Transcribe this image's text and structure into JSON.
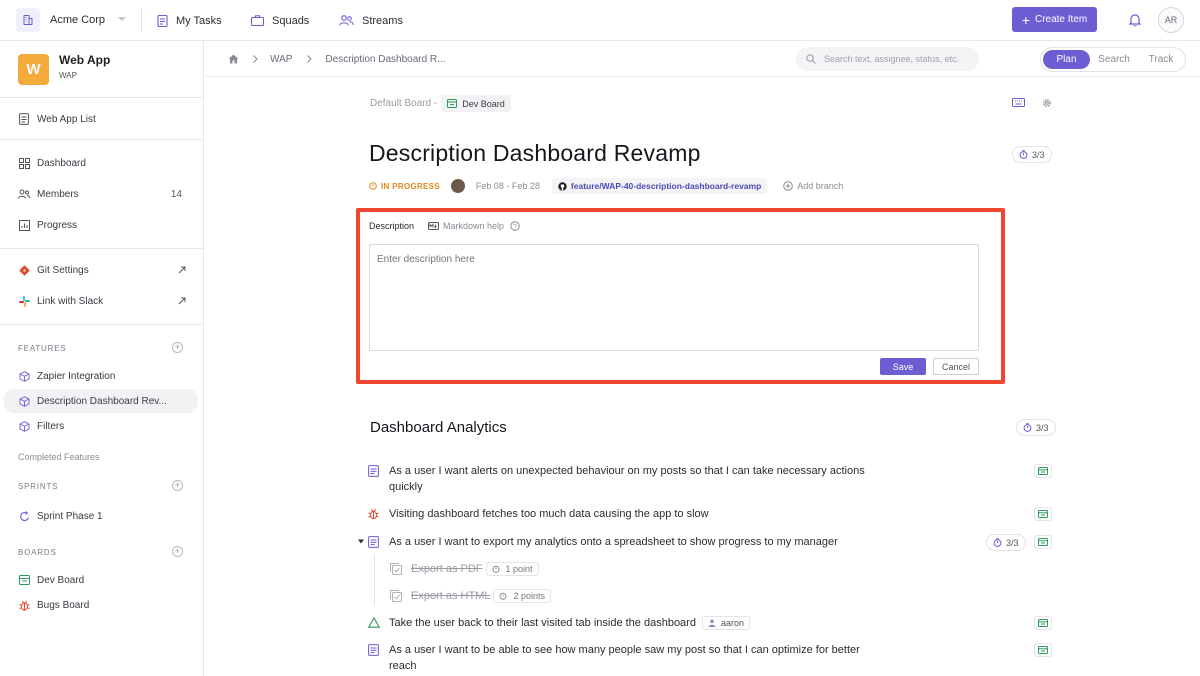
{
  "topbar": {
    "org": "Acme Corp",
    "nav": [
      "My Tasks",
      "Squads",
      "Streams"
    ],
    "create_label": "Create Item",
    "avatar_initials": "AR"
  },
  "sidebar": {
    "project_logo": "W",
    "project_name": "Web App",
    "project_key": "WAP",
    "list_link": "Web App List",
    "items": [
      {
        "label": "Dashboard",
        "icon": "grid-icon"
      },
      {
        "label": "Members",
        "icon": "users-icon",
        "count": "14"
      },
      {
        "label": "Progress",
        "icon": "chart-icon"
      }
    ],
    "links": [
      {
        "label": "Git Settings",
        "icon": "git-icon"
      },
      {
        "label": "Link with Slack",
        "icon": "slack-icon"
      }
    ],
    "features_heading": "FEATURES",
    "features": [
      "Zapier Integration",
      "Description Dashboard Rev...",
      "Filters"
    ],
    "completed_features": "Completed Features",
    "sprints_heading": "SPRINTS",
    "sprints": [
      "Sprint Phase 1"
    ],
    "boards_heading": "BOARDS",
    "boards": [
      "Dev Board",
      "Bugs Board"
    ]
  },
  "header": {
    "breadcrumb": [
      "WAP",
      "Description Dashboard R..."
    ],
    "search_placeholder": "Search text, assignee, status, etc.",
    "modes": [
      "Plan",
      "Search",
      "Track"
    ],
    "active_mode": "Plan"
  },
  "feature": {
    "board_prefix": "Default Board -",
    "board_name": "Dev Board",
    "title": "Description Dashboard Revamp",
    "progress": "3/3",
    "status": "IN PROGRESS",
    "dates": "Feb 08 - Feb 28",
    "branch": "feature/WAP-40-description-dashboard-revamp",
    "add_branch": "Add branch",
    "description_label": "Description",
    "markdown_help": "Markdown help",
    "description_placeholder": "Enter description here",
    "save_label": "Save",
    "cancel_label": "Cancel"
  },
  "section": {
    "title": "Dashboard Analytics",
    "progress": "3/3",
    "rows": [
      {
        "text": "As a user I want alerts on unexpected behaviour on my posts so that I can take necessary actions",
        "text2": "quickly",
        "type": "story"
      },
      {
        "text": "Visiting dashboard fetches too much data causing the app to slow",
        "type": "bug"
      },
      {
        "text": "As a user I want to export my analytics onto a spreadsheet to show progress to my manager",
        "type": "story",
        "progress": "3/3"
      },
      {
        "text": "Export as PDF",
        "points": "1 point",
        "type": "subtask"
      },
      {
        "text": "Export as HTML",
        "points": "2 points",
        "type": "subtask"
      },
      {
        "text": "Take the user back to their last visited tab inside the dashboard",
        "assignee": "aaron",
        "type": "task"
      },
      {
        "text": "As a user I want to be able to see how many people saw my post so that I can optimize for better",
        "text2": "reach",
        "type": "story"
      }
    ]
  },
  "colors": {
    "accent": "#6c5dd3",
    "highlight": "#f0452e",
    "status": "#e0891c"
  }
}
